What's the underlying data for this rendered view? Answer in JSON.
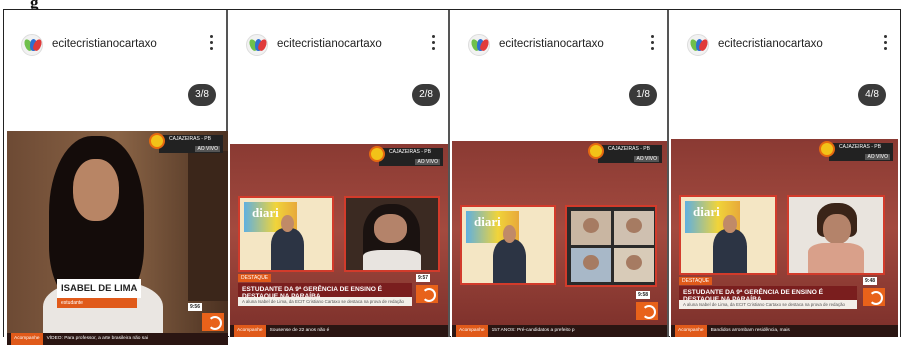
{
  "caption": "g",
  "panels": [
    {
      "username": "ecitecristianocartaxo",
      "counter": "3/8",
      "tv": {
        "city": "CAJAZEIRAS - PB",
        "live": "AO VIVO",
        "name": "ISABEL DE LIMA",
        "role": "estudante",
        "clock": "9:56",
        "ticker_tag": "Acompanhe",
        "ticker": "VÍDEO: Para professor, a arte brasileira não sai"
      }
    },
    {
      "username": "ecitecristianocartaxo",
      "counter": "2/8",
      "tv": {
        "city": "CAJAZEIRAS - PB",
        "live": "AO VIVO",
        "board": "diari",
        "tag": "DESTAQUE",
        "headline": "ESTUDANTE DA 9ª GERÊNCIA DE ENSINO É DESTAQUE NA PARAÍBA",
        "sub": "A aluna Isabel de Lima, da ECIT Cristiano Cartaxo se destaca na prova de redação",
        "clock": "9:57",
        "ticker_tag": "Acompanhe",
        "ticker": "Sousense de 22 anos não é"
      }
    },
    {
      "username": "ecitecristianocartaxo",
      "counter": "1/8",
      "tv": {
        "city": "CAJAZEIRAS - PB",
        "live": "AO VIVO",
        "board": "diari",
        "clock": "9:58",
        "ticker_tag": "Acompanhe",
        "ticker": "157 ANOS: Pré-candidatos a prefeito p"
      }
    },
    {
      "username": "ecitecristianocartaxo",
      "counter": "4/8",
      "tv": {
        "city": "CAJAZEIRAS - PB",
        "live": "AO VIVO",
        "board": "diari",
        "tag": "DESTAQUE",
        "headline": "ESTUDANTE DA 9ª GERÊNCIA DE ENSINO É DESTAQUE NA PARAÍBA",
        "sub": "A aluna Isabel de Lima, da ECIT Cristiano Cartaxo se destaca na prova de redação",
        "clock": "9:48",
        "ticker_tag": "Acompanhe",
        "ticker": "Bandidos arrombam residência, mais"
      }
    }
  ],
  "icons": {
    "avatar": "school-logo-icon",
    "menu": "more-vertical-icon"
  }
}
